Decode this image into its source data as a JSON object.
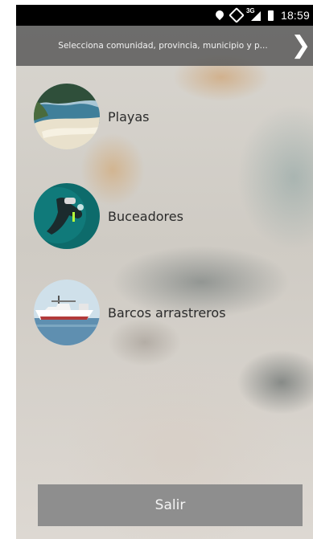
{
  "status_bar": {
    "network_type": "3G",
    "time": "18:59",
    "icons": [
      "location-pin-icon",
      "screen-rotation-icon",
      "signal-icon",
      "battery-icon"
    ]
  },
  "location_bar": {
    "prompt": "Selecciona comunidad, provincia, municipio y p...",
    "next_icon": "chevron-right-icon"
  },
  "categories": [
    {
      "label": "Playas",
      "image": "beach-thumbnail"
    },
    {
      "label": "Buceadores",
      "image": "diver-thumbnail"
    },
    {
      "label": "Barcos arrastreros",
      "image": "trawler-boat-thumbnail"
    }
  ],
  "exit_button": {
    "label": "Salir",
    "color": "#8e8e8e"
  }
}
